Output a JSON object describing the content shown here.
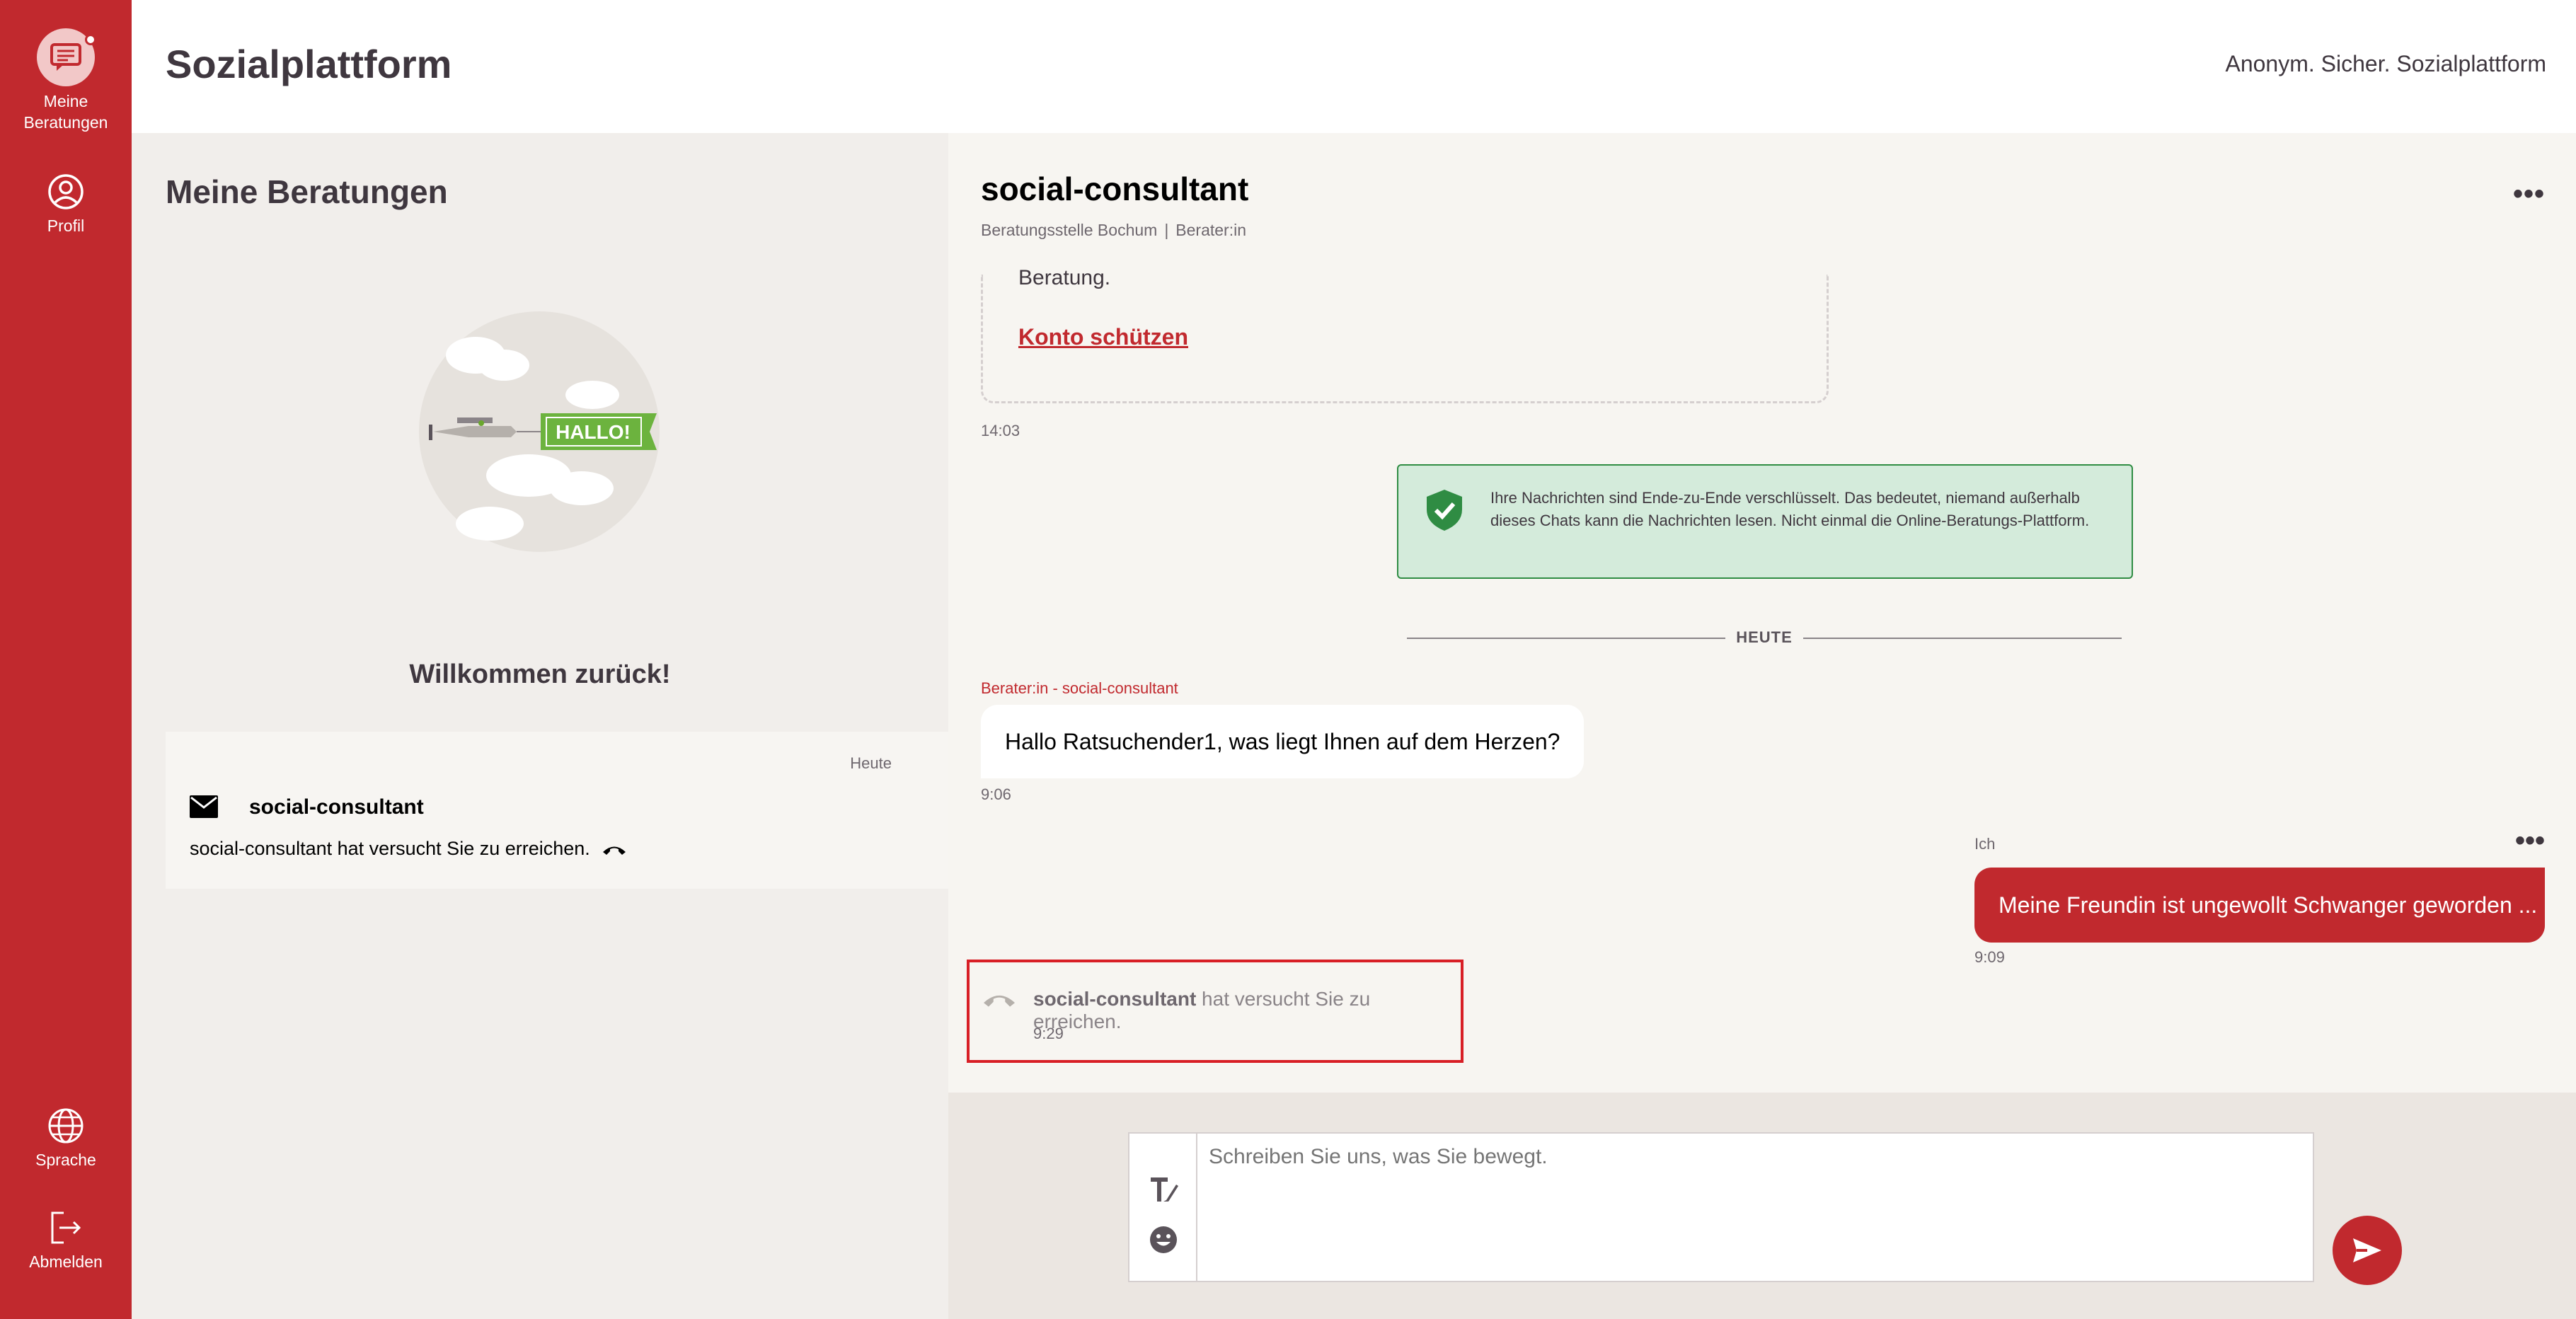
{
  "nav": {
    "consultations_label": "Meine\nBeratungen",
    "profile_label": "Profil",
    "language_label": "Sprache",
    "logout_label": "Abmelden"
  },
  "header": {
    "brand": "Sozialplattform",
    "tagline": "Anonym. Sicher. Sozialplattform"
  },
  "left_panel": {
    "title": "Meine Beratungen",
    "illustration_text": "HALLO!",
    "welcome": "Willkommen zurück!",
    "session": {
      "date": "Heute",
      "name": "social-consultant",
      "text": "social-consultant hat versucht Sie zu erreichen."
    }
  },
  "chat": {
    "title": "social-consultant",
    "agency": "Beratungsstelle Bochum",
    "separator": "|",
    "role": "Berater:in",
    "menu": "•••",
    "card_text": "Beratung.",
    "card_link": "Konto schützen",
    "card_time": "14:03",
    "e2e_text": "Ihre Nachrichten sind Ende-zu-Ende verschlüsselt. Das bedeutet, niemand außerhalb dieses Chats kann die Nachrichten lesen. Nicht einmal die Online-Beratungs-Plattform.",
    "divider": "HEUTE",
    "incoming": {
      "sender": "Berater:in - social-consultant",
      "text": "Hallo Ratsuchender1, was liegt Ihnen auf dem Herzen?",
      "time": "9:06"
    },
    "outgoing": {
      "sender": "Ich",
      "menu": "•••",
      "text": "Meine Freundin ist ungewollt Schwanger geworden ...",
      "time": "9:09"
    },
    "call": {
      "name": "social-consultant",
      "text": " hat versucht Sie zu erreichen.",
      "time": "9:29"
    }
  },
  "composer": {
    "placeholder": "Schreiben Sie uns, was Sie bewegt."
  },
  "colors": {
    "brand_red": "#c1292e",
    "success_green": "#2f8c43",
    "success_bg": "#d4ebdb"
  }
}
